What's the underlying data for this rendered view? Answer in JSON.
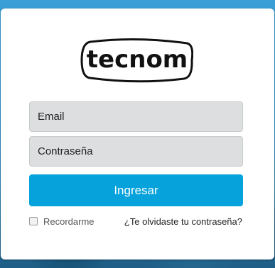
{
  "logo": {
    "text": "tecnom"
  },
  "form": {
    "email_placeholder": "Email",
    "password_placeholder": "Contraseña",
    "submit_label": "Ingresar",
    "remember_label": "Recordarme",
    "remember_checked": false,
    "forgot_label": "¿Te olvidaste tu contraseña?"
  },
  "colors": {
    "accent": "#06a2db",
    "background": "#3a9fd6",
    "input_fill": "#dcdedf"
  }
}
